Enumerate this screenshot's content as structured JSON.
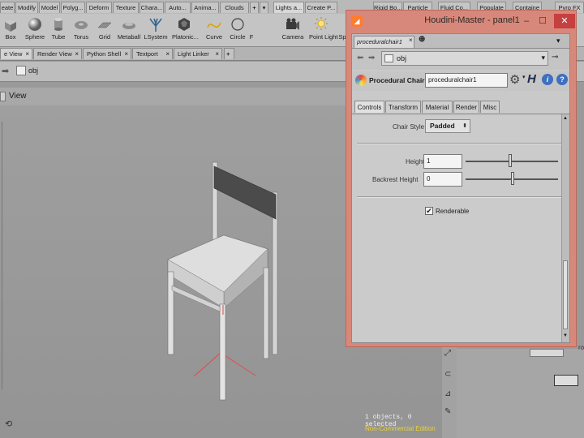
{
  "colors": {
    "accent_panel": "#d8887a",
    "noncommercial": "#e8d23a"
  },
  "shelf": {
    "tabs": [
      "eate",
      "Modify",
      "Model",
      "Polyg...",
      "Deform",
      "Texture",
      "Chara...",
      "Auto...",
      "Anima...",
      "Clouds",
      "Lights a...",
      "Create P...",
      "Fluid Co...",
      "Populate",
      "Containe",
      "Pyro FX"
    ],
    "tabs_hidden": [
      "Rigid Bo...",
      "Particle"
    ],
    "tools": [
      "Box",
      "Sphere",
      "Tube",
      "Torus",
      "Grid",
      "Metaball",
      "LSystem",
      "Platonic...",
      "Curve",
      "Circle",
      "F",
      "Camera",
      "Point Light",
      "Sp"
    ]
  },
  "panes": {
    "tabs": [
      "e View",
      "Render View",
      "Python Shell",
      "Textport",
      "Light Linker"
    ]
  },
  "path": {
    "value": "obj"
  },
  "view": {
    "label": "View"
  },
  "viewport": {
    "status": "1 objects, 0 selected",
    "edition": "Non-Commercial Edition"
  },
  "panel": {
    "title": "Houdini-Master - panel1",
    "tab": "proceduralchair1",
    "path": "obj",
    "node_type": "Procedural Chair",
    "node_name": "proceduralchair1",
    "h_label": "H",
    "tabs": [
      "Controls",
      "Transform",
      "Material",
      "Render",
      "Misc"
    ],
    "chair_style_label": "Chair Style",
    "chair_style_value": "Padded",
    "height_label": "Height",
    "height_value": "1",
    "height_slider": 0.5,
    "backrest_label": "Backrest Height",
    "backrest_value": "0",
    "backrest_slider": 0.5,
    "renderable_label": "Renderable",
    "renderable_checked": true
  },
  "network": {
    "label": "roce"
  }
}
